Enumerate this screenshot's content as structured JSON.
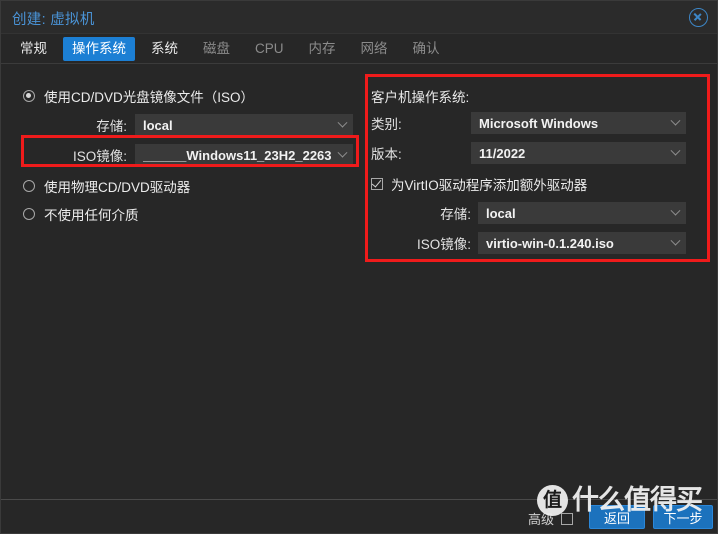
{
  "window": {
    "title": "创建: 虚拟机",
    "close_icon": "close-circle-icon"
  },
  "tabs": [
    {
      "label": "常规",
      "state": "normal"
    },
    {
      "label": "操作系统",
      "state": "active"
    },
    {
      "label": "系统",
      "state": "normal"
    },
    {
      "label": "磁盘",
      "state": "dim"
    },
    {
      "label": "CPU",
      "state": "dim"
    },
    {
      "label": "内存",
      "state": "dim"
    },
    {
      "label": "网络",
      "state": "dim"
    },
    {
      "label": "确认",
      "state": "dim"
    }
  ],
  "left_panel": {
    "option_iso": {
      "label": "使用CD/DVD光盘镜像文件（ISO）",
      "selected": true
    },
    "storage": {
      "label": "存储:",
      "value": "local"
    },
    "iso_image": {
      "label": "ISO镜像:",
      "value": "______Windows11_23H2_2263'"
    },
    "option_physical": {
      "label": "使用物理CD/DVD驱动器",
      "selected": false
    },
    "option_none": {
      "label": "不使用任何介质",
      "selected": false
    }
  },
  "right_panel": {
    "heading": "客户机操作系统:",
    "category": {
      "label": "类别:",
      "value": "Microsoft Windows"
    },
    "version": {
      "label": "版本:",
      "value": "11/2022"
    },
    "virtio": {
      "label": "为VirtIO驱动程序添加额外驱动器",
      "checked": true
    },
    "virtio_storage": {
      "label": "存储:",
      "value": "local"
    },
    "virtio_iso": {
      "label": "ISO镜像:",
      "value": "virtio-win-0.1.240.iso"
    }
  },
  "footer": {
    "advanced": {
      "label": "高级",
      "checked": false
    },
    "back_label": "返回",
    "next_label": "下一步"
  },
  "watermark": {
    "logo_char": "值",
    "text": "什么值得买"
  },
  "colors": {
    "accent_blue": "#1c7fd4",
    "title_blue": "#4a93d6",
    "annotation_red": "#ef1b1b",
    "panel_bg": "#272727",
    "field_bg": "#3a3a3a"
  }
}
